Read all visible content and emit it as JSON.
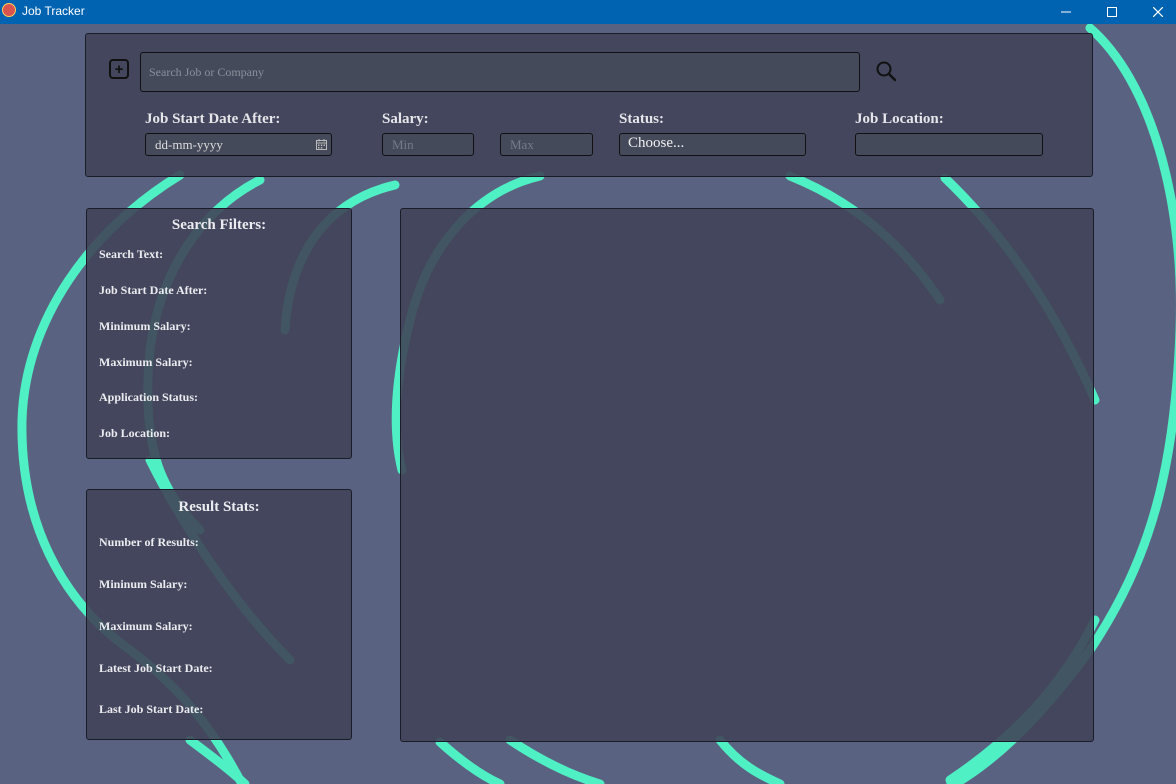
{
  "window": {
    "title": "Job Tracker",
    "icon": "job-tracker-app-icon",
    "controls": [
      "minimize-icon",
      "maximize-icon",
      "close-icon"
    ]
  },
  "search": {
    "placeholder": "Search Job or Company",
    "value": "",
    "add_icon": "plus-square-icon",
    "search_icon": "magnifier-icon"
  },
  "filters_bar": {
    "date_label": "Job Start Date After:",
    "date_value": "dd-mm-yyyy",
    "salary_label": "Salary:",
    "salary_min_placeholder": "Min",
    "salary_max_placeholder": "Max",
    "status_label": "Status:",
    "status_selected": "Choose...",
    "location_label": "Job Location:",
    "location_value": ""
  },
  "search_filters": {
    "title": "Search Filters:",
    "rows": [
      "Search Text:",
      "Job Start Date After:",
      "Minimum Salary:",
      "Maximum Salary:",
      "Application Status:",
      "Job Location:"
    ]
  },
  "result_stats": {
    "title": "Result Stats:",
    "rows": [
      "Number of Results:",
      "Mininum Salary:",
      "Maximum Salary:",
      "Latest Job Start Date:",
      "Last Job Start Date:"
    ]
  },
  "colors": {
    "titlebar": "#0063b1",
    "background": "#5a6282",
    "accent_swirl": "#4ef0c4",
    "panel": "#404458"
  }
}
